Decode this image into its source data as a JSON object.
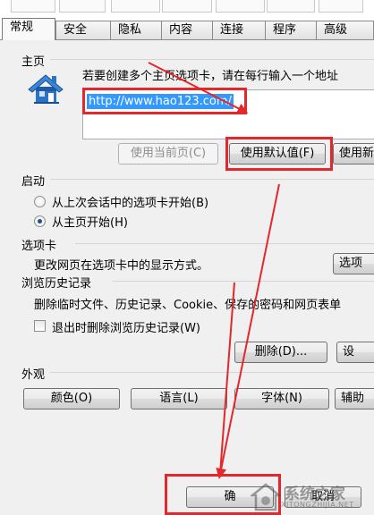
{
  "tabs": [
    "常规",
    "安全",
    "隐私",
    "内容",
    "连接",
    "程序",
    "高级"
  ],
  "home": {
    "title": "主页",
    "instruction": "若要创建多个主页选项卡，请在每行输入一个地址",
    "url": "http://www.hao123.com/",
    "btn_current": "使用当前页(C)",
    "btn_default": "使用默认值(F)",
    "btn_new": "使用新"
  },
  "startup": {
    "title": "启动",
    "option1": "从上次会话中的选项卡开始(B)",
    "option2": "从主页开始(H)",
    "selected": "option2"
  },
  "tabs_section": {
    "title": "选项卡",
    "desc": "更改网页在选项卡中的显示方式。",
    "btn": "选项"
  },
  "history": {
    "title": "浏览历史记录",
    "desc": "删除临时文件、历史记录、Cookie、保存的密码和网页表单",
    "checkbox_label": "退出时删除浏览历史记录(W)",
    "checked": false,
    "btn_delete": "删除(D)...",
    "btn_settings": "设"
  },
  "appearance": {
    "title": "外观",
    "btn_colors": "颜色(O)",
    "btn_languages": "语言(L)",
    "btn_fonts": "字体(N)",
    "btn_accessibility": "辅助"
  },
  "footer": {
    "btn_ok": "确",
    "btn_cancel": "取消"
  },
  "watermark": {
    "text": "系统之家",
    "sub": "XITONGZHIJIA.NET"
  },
  "colors": {
    "highlight": "#e2282b",
    "selection": "#3399ff"
  }
}
